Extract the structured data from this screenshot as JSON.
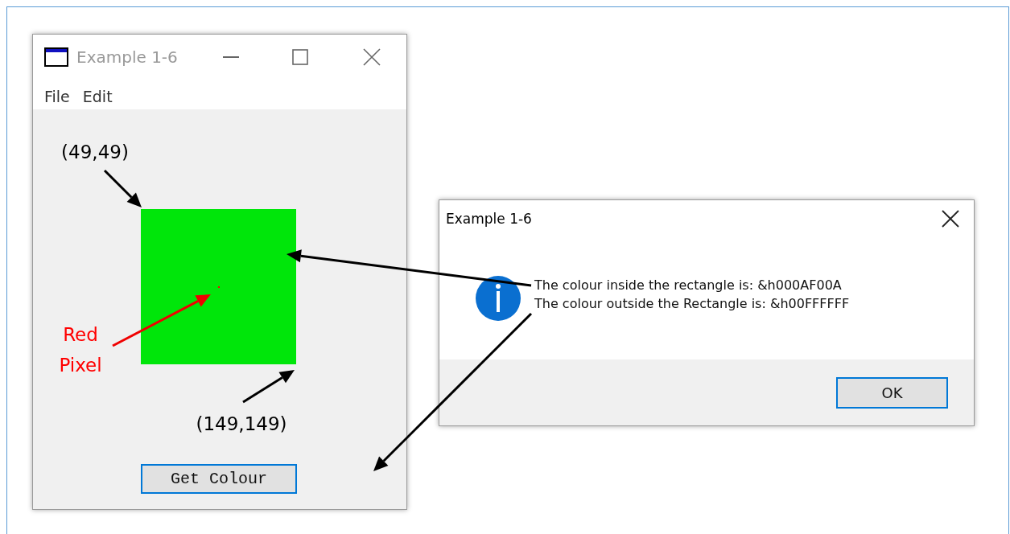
{
  "main_window": {
    "title": "Example 1-6",
    "active": false,
    "menu": [
      "File",
      "Edit"
    ],
    "button": "Get Colour"
  },
  "dialog": {
    "title": "Example 1-6",
    "active": true,
    "messages": [
      "The colour inside the rectangle is: &h000AF00A",
      "The colour outside the Rectangle is: &h00FFFFFF"
    ],
    "button": "OK"
  },
  "annotations": [
    {
      "text": "(49,49)",
      "color": "#000000"
    },
    {
      "text": "Red Pixel",
      "color": "#ff0000"
    },
    {
      "text": "(149,149)",
      "color": "#000000"
    }
  ]
}
